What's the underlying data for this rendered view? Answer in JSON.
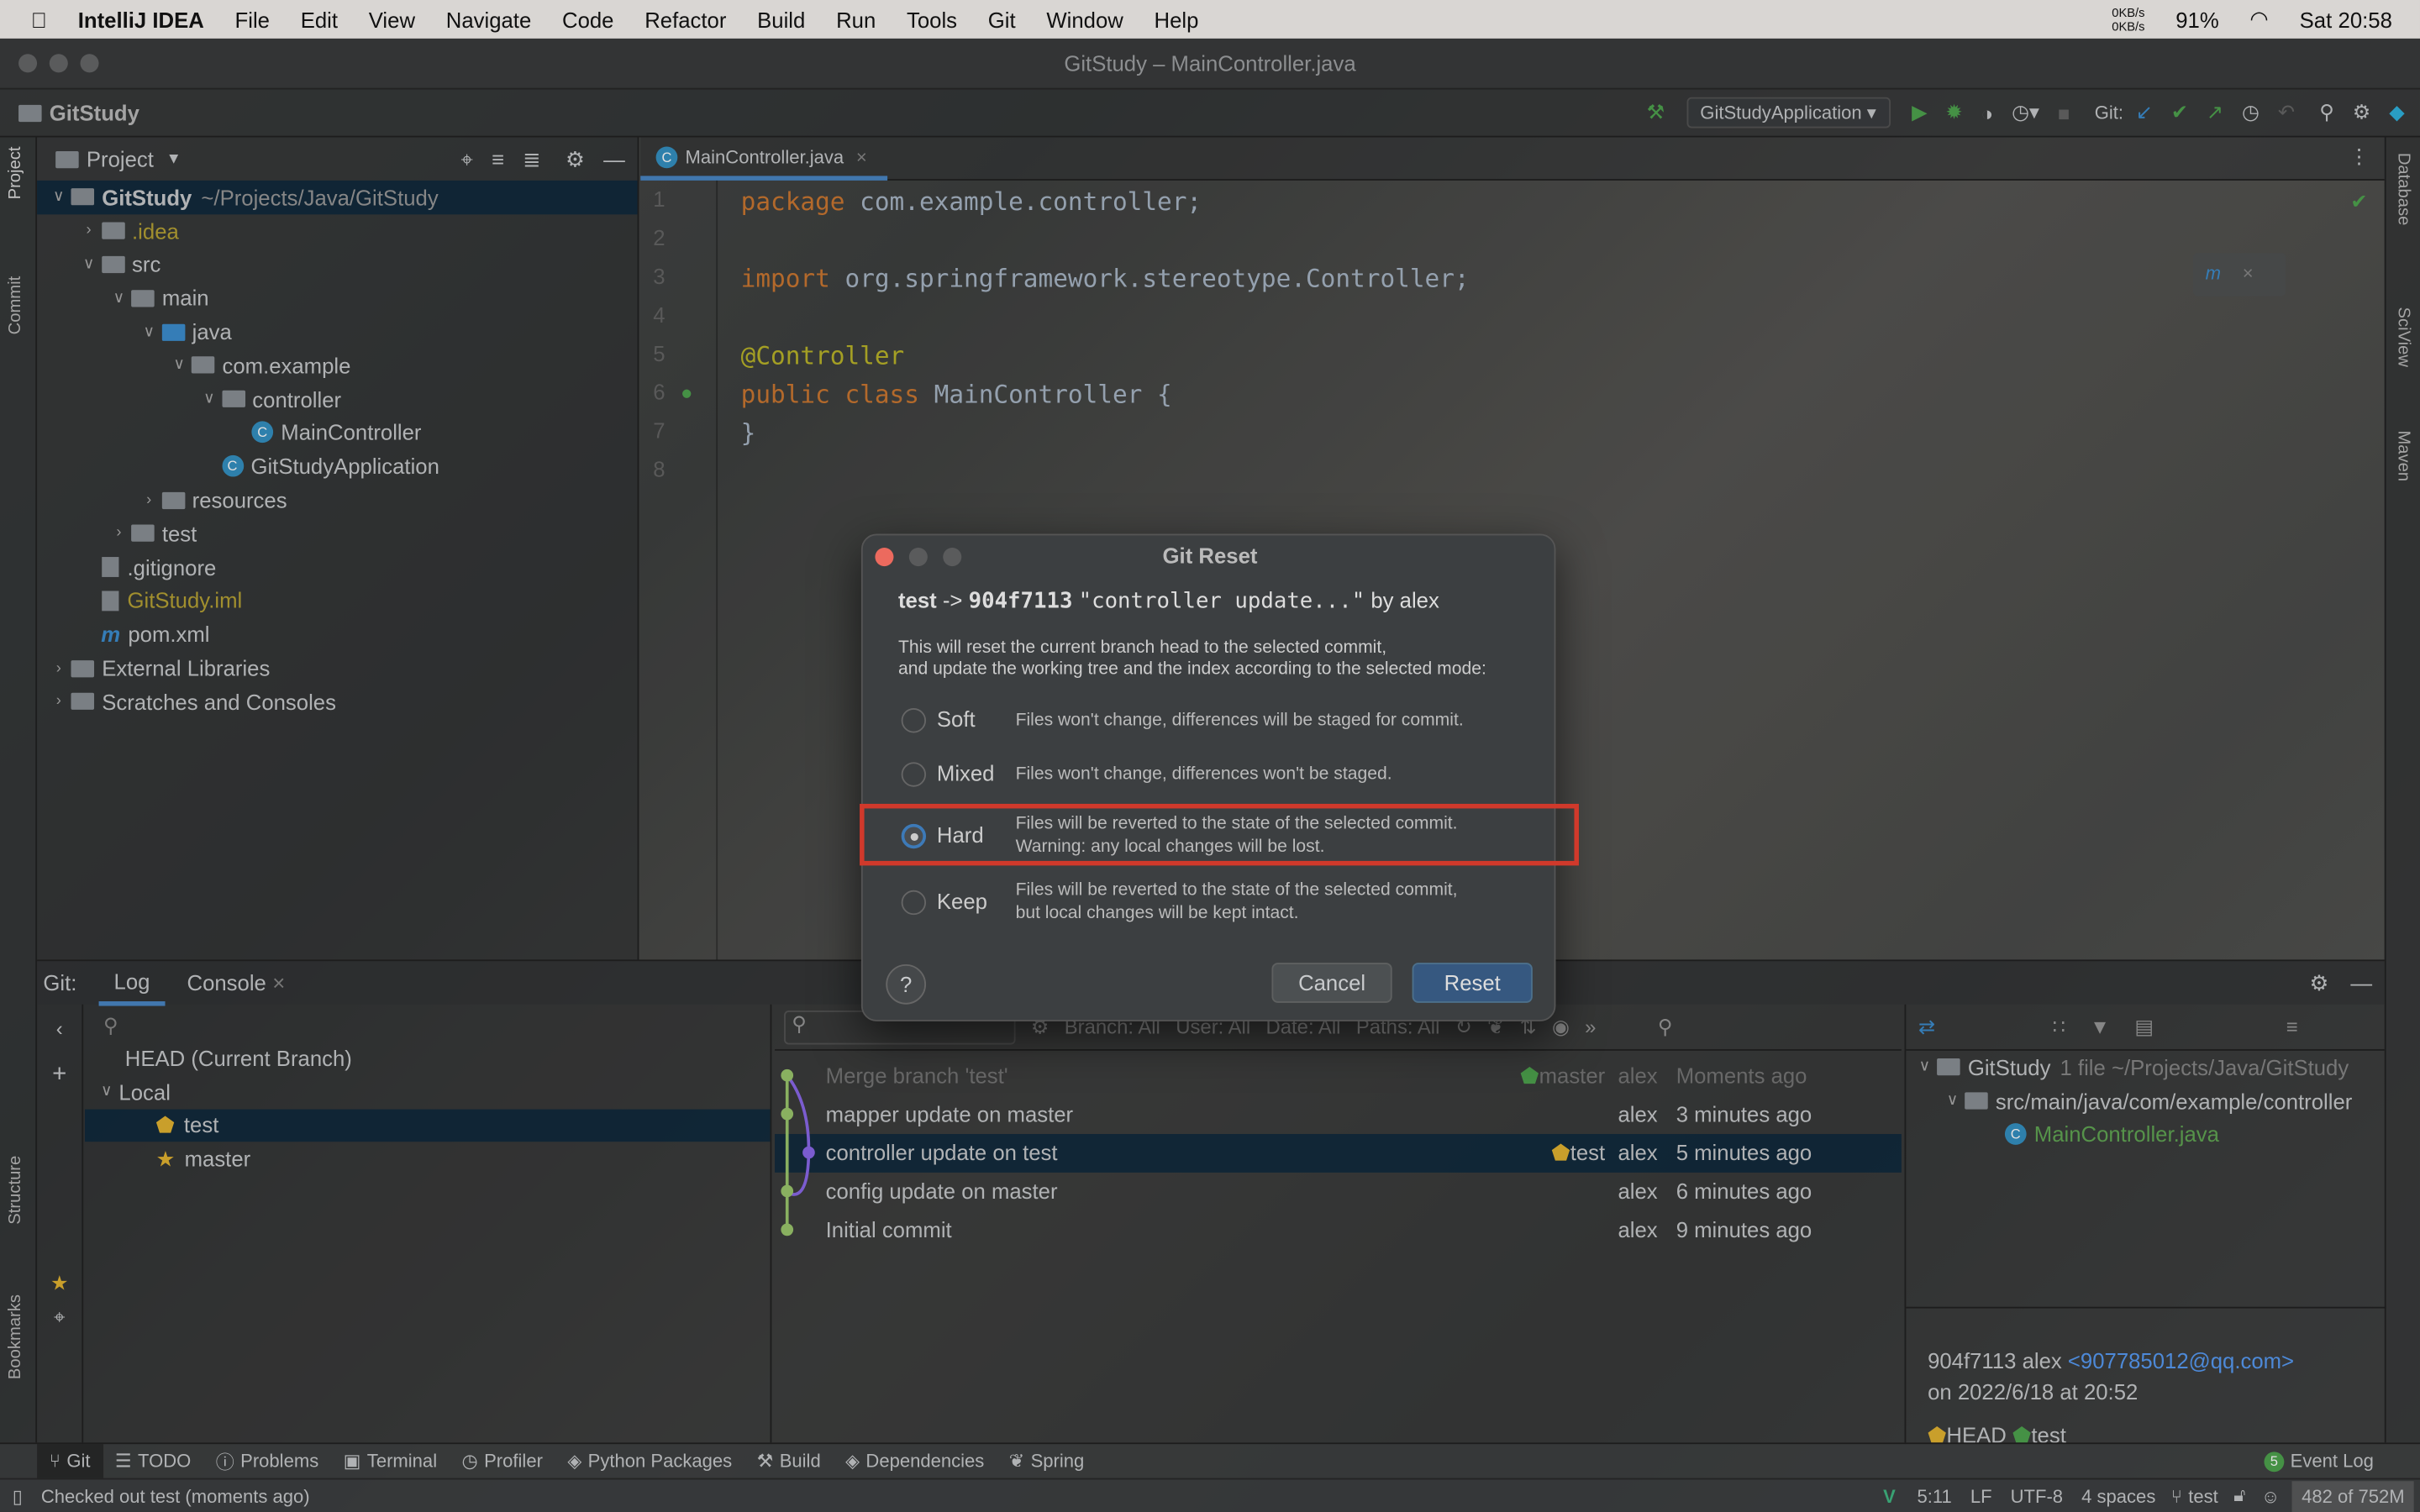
{
  "menubar": {
    "app": "IntelliJ IDEA",
    "items": [
      "File",
      "Edit",
      "View",
      "Navigate",
      "Code",
      "Refactor",
      "Build",
      "Run",
      "Tools",
      "Git",
      "Window",
      "Help"
    ],
    "net_up": "0KB/s",
    "net_down": "0KB/s",
    "battery": "91%",
    "clock_day": "Sat",
    "clock_time": "20:58"
  },
  "window": {
    "title": "GitStudy – MainController.java"
  },
  "toolbar": {
    "project": "GitStudy",
    "run_config": "GitStudyApplication",
    "git_label": "Git:"
  },
  "left_stripe": {
    "project": "Project",
    "commit": "Commit",
    "structure": "Structure",
    "bookmarks": "Bookmarks"
  },
  "right_stripe": {
    "database": "Database",
    "sciview": "SciView",
    "maven": "Maven"
  },
  "project_panel": {
    "title": "Project",
    "tree": [
      {
        "label": "GitStudy",
        "extra": "~/Projects/Java/GitStudy",
        "depth": 0,
        "type": "folder",
        "open": true
      },
      {
        "label": ".idea",
        "depth": 1,
        "type": "folder",
        "open": false
      },
      {
        "label": "src",
        "depth": 1,
        "type": "folder",
        "open": true
      },
      {
        "label": "main",
        "depth": 2,
        "type": "folder",
        "open": true
      },
      {
        "label": "java",
        "depth": 3,
        "type": "folder",
        "open": true
      },
      {
        "label": "com.example",
        "depth": 4,
        "type": "package",
        "open": true
      },
      {
        "label": "controller",
        "depth": 5,
        "type": "package",
        "open": true
      },
      {
        "label": "MainController",
        "depth": 6,
        "type": "class"
      },
      {
        "label": "GitStudyApplication",
        "depth": 5,
        "type": "class"
      },
      {
        "label": "resources",
        "depth": 3,
        "type": "folder",
        "open": false
      },
      {
        "label": "test",
        "depth": 2,
        "type": "folder",
        "open": false
      },
      {
        "label": ".gitignore",
        "depth": 1,
        "type": "file"
      },
      {
        "label": "GitStudy.iml",
        "depth": 1,
        "type": "file"
      },
      {
        "label": "pom.xml",
        "depth": 1,
        "type": "maven"
      },
      {
        "label": "External Libraries",
        "depth": 0,
        "type": "lib",
        "open": false
      },
      {
        "label": "Scratches and Consoles",
        "depth": 0,
        "type": "scratch",
        "open": false
      }
    ]
  },
  "editor": {
    "tab": "MainController.java",
    "lines": [
      {
        "n": "1",
        "parts": [
          [
            "kw",
            "package "
          ],
          [
            "pl",
            "com.example.controller;"
          ]
        ]
      },
      {
        "n": "2",
        "parts": []
      },
      {
        "n": "3",
        "parts": [
          [
            "kw",
            "import "
          ],
          [
            "pl",
            "org.springframework.stereotype.Controller;"
          ]
        ]
      },
      {
        "n": "4",
        "parts": []
      },
      {
        "n": "5",
        "parts": [
          [
            "an",
            "@Controller"
          ]
        ]
      },
      {
        "n": "6",
        "parts": [
          [
            "kw",
            "public class "
          ],
          [
            "pl",
            "MainController {"
          ]
        ]
      },
      {
        "n": "7",
        "parts": [
          [
            "pl",
            "}"
          ]
        ]
      },
      {
        "n": "8",
        "parts": []
      }
    ]
  },
  "git_panel": {
    "label": "Git:",
    "tabs": [
      "Log",
      "Console"
    ],
    "branches": {
      "head": "HEAD (Current Branch)",
      "local": "Local",
      "items": [
        "test",
        "master"
      ]
    },
    "filters": {
      "branch": "Branch: All",
      "user": "User: All",
      "date": "Date: All",
      "paths": "Paths: All"
    },
    "commits": [
      {
        "msg": "Merge branch 'test'",
        "tag": "master",
        "author": "alex",
        "time": "Moments ago",
        "dim": true
      },
      {
        "msg": "mapper update on master",
        "tag": "",
        "author": "alex",
        "time": "3 minutes ago"
      },
      {
        "msg": "controller update on test",
        "tag": "test",
        "author": "alex",
        "time": "5 minutes ago",
        "selected": true
      },
      {
        "msg": "config update on master",
        "tag": "",
        "author": "alex",
        "time": "6 minutes ago"
      },
      {
        "msg": "Initial commit",
        "tag": "",
        "author": "alex",
        "time": "9 minutes ago"
      }
    ],
    "changes": {
      "root": "GitStudy",
      "root_extra": "1 file  ~/Projects/Java/GitStudy",
      "dir": "src/main/java/com/example/controller",
      "file": "MainController.java"
    },
    "details": {
      "hash_author": "904f7113 alex",
      "email": "<907785012@qq.com>",
      "date": "on 2022/6/18 at 20:52",
      "refs": [
        "HEAD",
        "test"
      ]
    }
  },
  "dialog": {
    "title": "Git Reset",
    "branch": "test",
    "arrow": "->",
    "hash": "904f7113",
    "commit": "\"controller update...\"",
    "by": "by alex",
    "desc1": "This will reset the current branch head to the selected commit,",
    "desc2": "and update the working tree and the index according to the selected mode:",
    "modes": [
      {
        "label": "Soft",
        "desc1": "Files won't change, differences will be staged for commit.",
        "desc2": ""
      },
      {
        "label": "Mixed",
        "desc1": "Files won't change, differences won't be staged.",
        "desc2": ""
      },
      {
        "label": "Hard",
        "desc1": "Files will be reverted to the state of the selected commit.",
        "desc2": "Warning: any local changes will be lost.",
        "selected": true
      },
      {
        "label": "Keep",
        "desc1": "Files will be reverted to the state of the selected commit,",
        "desc2": "but local changes will be kept intact."
      }
    ],
    "help": "?",
    "cancel": "Cancel",
    "reset": "Reset",
    "highlight_color": "#d0392b",
    "accent": "#365880"
  },
  "tool_windows": [
    "Git",
    "TODO",
    "Problems",
    "Terminal",
    "Profiler",
    "Python Packages",
    "Build",
    "Dependencies",
    "Spring"
  ],
  "event_log": {
    "count": "5",
    "label": "Event Log"
  },
  "status": {
    "message": "Checked out test (moments ago)",
    "position": "5:11",
    "line_sep": "LF",
    "encoding": "UTF-8",
    "indent": "4 spaces",
    "branch": "test",
    "memory": "482 of 752M"
  }
}
